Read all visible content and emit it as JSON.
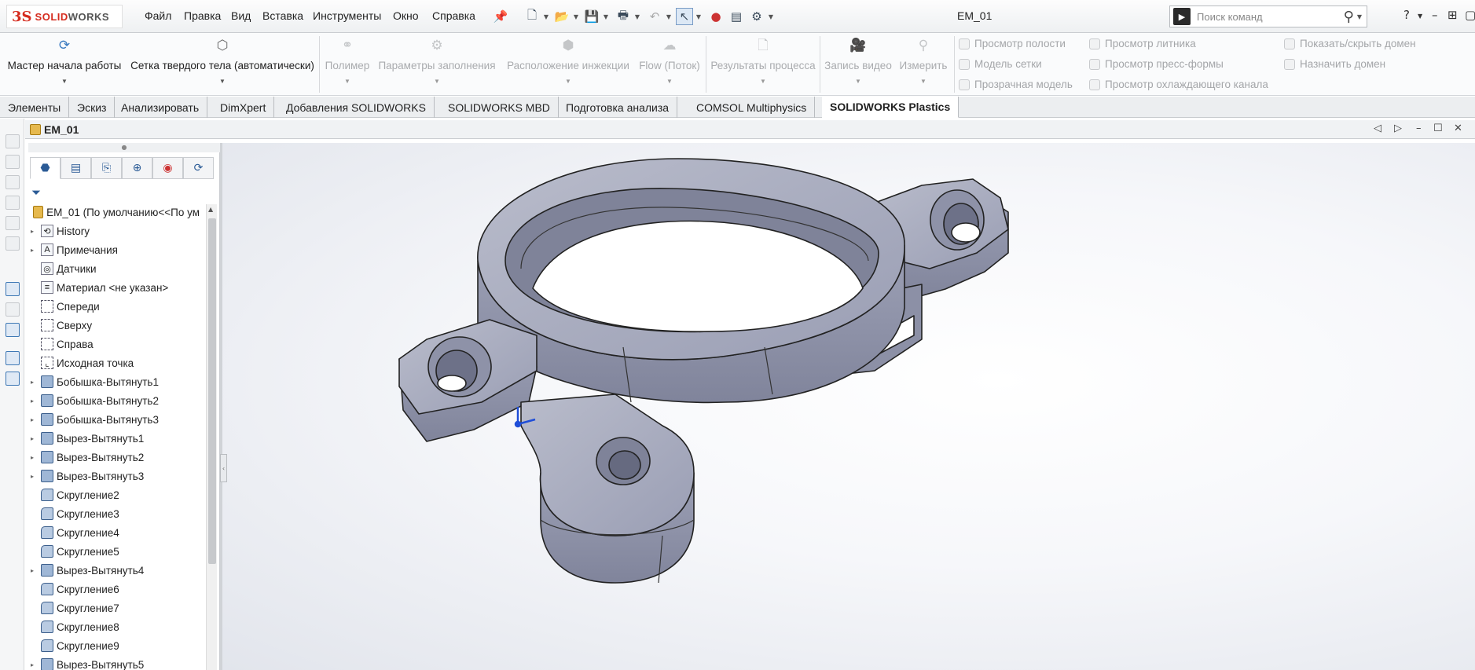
{
  "app": {
    "logo_ds": "3S",
    "logo_solid": "SOLID",
    "logo_works": "WORKS"
  },
  "menu": [
    "Файл",
    "Правка",
    "Вид",
    "Вставка",
    "Инструменты",
    "Окно",
    "Справка"
  ],
  "document_title": "EM_01",
  "command_search": {
    "placeholder": "Поиск команд"
  },
  "ribbon": {
    "buttons": [
      {
        "label": "Мастер начала работы",
        "icon": "wizard-icon",
        "enabled": true
      },
      {
        "label": "Сетка твердого тела (автоматически)",
        "icon": "solid-mesh-icon",
        "enabled": true
      },
      {
        "label": "Полимер",
        "icon": "polymer-icon",
        "enabled": false
      },
      {
        "label": "Параметры заполнения",
        "icon": "fill-settings-icon",
        "enabled": false
      },
      {
        "label": "Расположение инжекции",
        "icon": "injection-location-icon",
        "enabled": false
      },
      {
        "label": "Flow (Поток)",
        "icon": "flow-icon",
        "enabled": false
      },
      {
        "label": "Результаты процесса",
        "icon": "process-results-icon",
        "enabled": false
      },
      {
        "label": "Запись видео",
        "icon": "record-video-icon",
        "enabled": false
      },
      {
        "label": "Измерить",
        "icon": "measure-icon",
        "enabled": false
      }
    ],
    "small_col1": [
      "Просмотр полости",
      "Модель сетки",
      "Прозрачная модель"
    ],
    "small_col2": [
      "Просмотр литника",
      "Просмотр пресс-формы",
      "Просмотр охлаждающего канала"
    ],
    "small_col3": [
      "Показать/скрыть домен",
      "Назначить домен"
    ]
  },
  "tabs": [
    {
      "label": "Элементы",
      "active": false
    },
    {
      "label": "Эскиз",
      "active": false
    },
    {
      "label": "Анализировать",
      "active": false
    },
    {
      "label": "DimXpert",
      "active": false
    },
    {
      "label": "Добавления SOLIDWORKS",
      "active": false
    },
    {
      "label": "SOLIDWORKS MBD",
      "active": false
    },
    {
      "label": "Подготовка анализа",
      "active": false
    },
    {
      "label": "COMSOL Multiphysics",
      "active": false
    },
    {
      "label": "SOLIDWORKS Plastics",
      "active": true
    }
  ],
  "doc_window_title": "EM_01",
  "tree": {
    "root": "EM_01  (По умолчанию<<По ум",
    "items": [
      {
        "label": "History",
        "icon": "history-folder-icon",
        "expandable": true
      },
      {
        "label": "Примечания",
        "icon": "annotations-icon",
        "expandable": true
      },
      {
        "label": "Датчики",
        "icon": "sensors-icon",
        "expandable": false
      },
      {
        "label": "Материал <не указан>",
        "icon": "material-icon",
        "expandable": false
      },
      {
        "label": "Спереди",
        "icon": "plane-icon",
        "expandable": false
      },
      {
        "label": "Сверху",
        "icon": "plane-icon",
        "expandable": false
      },
      {
        "label": "Справа",
        "icon": "plane-icon",
        "expandable": false
      },
      {
        "label": "Исходная точка",
        "icon": "origin-icon",
        "expandable": false
      },
      {
        "label": "Бобышка-Вытянуть1",
        "icon": "boss-extrude-icon",
        "expandable": true
      },
      {
        "label": "Бобышка-Вытянуть2",
        "icon": "boss-extrude-icon",
        "expandable": true
      },
      {
        "label": "Бобышка-Вытянуть3",
        "icon": "boss-extrude-icon",
        "expandable": true
      },
      {
        "label": "Вырез-Вытянуть1",
        "icon": "cut-extrude-icon",
        "expandable": true
      },
      {
        "label": "Вырез-Вытянуть2",
        "icon": "cut-extrude-icon",
        "expandable": true
      },
      {
        "label": "Вырез-Вытянуть3",
        "icon": "cut-extrude-icon",
        "expandable": true
      },
      {
        "label": "Скругление2",
        "icon": "fillet-icon",
        "expandable": false
      },
      {
        "label": "Скругление3",
        "icon": "fillet-icon",
        "expandable": false
      },
      {
        "label": "Скругление4",
        "icon": "fillet-icon",
        "expandable": false
      },
      {
        "label": "Скругление5",
        "icon": "fillet-icon",
        "expandable": false
      },
      {
        "label": "Вырез-Вытянуть4",
        "icon": "cut-extrude-icon",
        "expandable": true
      },
      {
        "label": "Скругление6",
        "icon": "fillet-icon",
        "expandable": false
      },
      {
        "label": "Скругление7",
        "icon": "fillet-icon",
        "expandable": false
      },
      {
        "label": "Скругление8",
        "icon": "fillet-icon",
        "expandable": false
      },
      {
        "label": "Скругление9",
        "icon": "fillet-icon",
        "expandable": false
      },
      {
        "label": "Вырез-Вытянуть5",
        "icon": "cut-extrude-icon",
        "expandable": true
      }
    ]
  },
  "colors": {
    "accent": "#3b7bc0",
    "logo_red": "#d52b1e",
    "model_face": "#9ea2b8",
    "triad_blue": "#1f4ed8"
  }
}
